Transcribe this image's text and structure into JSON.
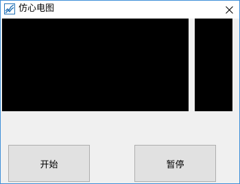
{
  "window": {
    "title": "仿心电图",
    "app_icon": "ecg-app-icon",
    "close_icon": "close-icon"
  },
  "screens": {
    "main_color": "#000000",
    "side_color": "#000000"
  },
  "buttons": {
    "start_label": "开始",
    "pause_label": "暂停"
  },
  "colors": {
    "window_border": "#3d8fd8",
    "window_bg": "#f0f0f0",
    "button_bg": "#e1e1e1"
  }
}
